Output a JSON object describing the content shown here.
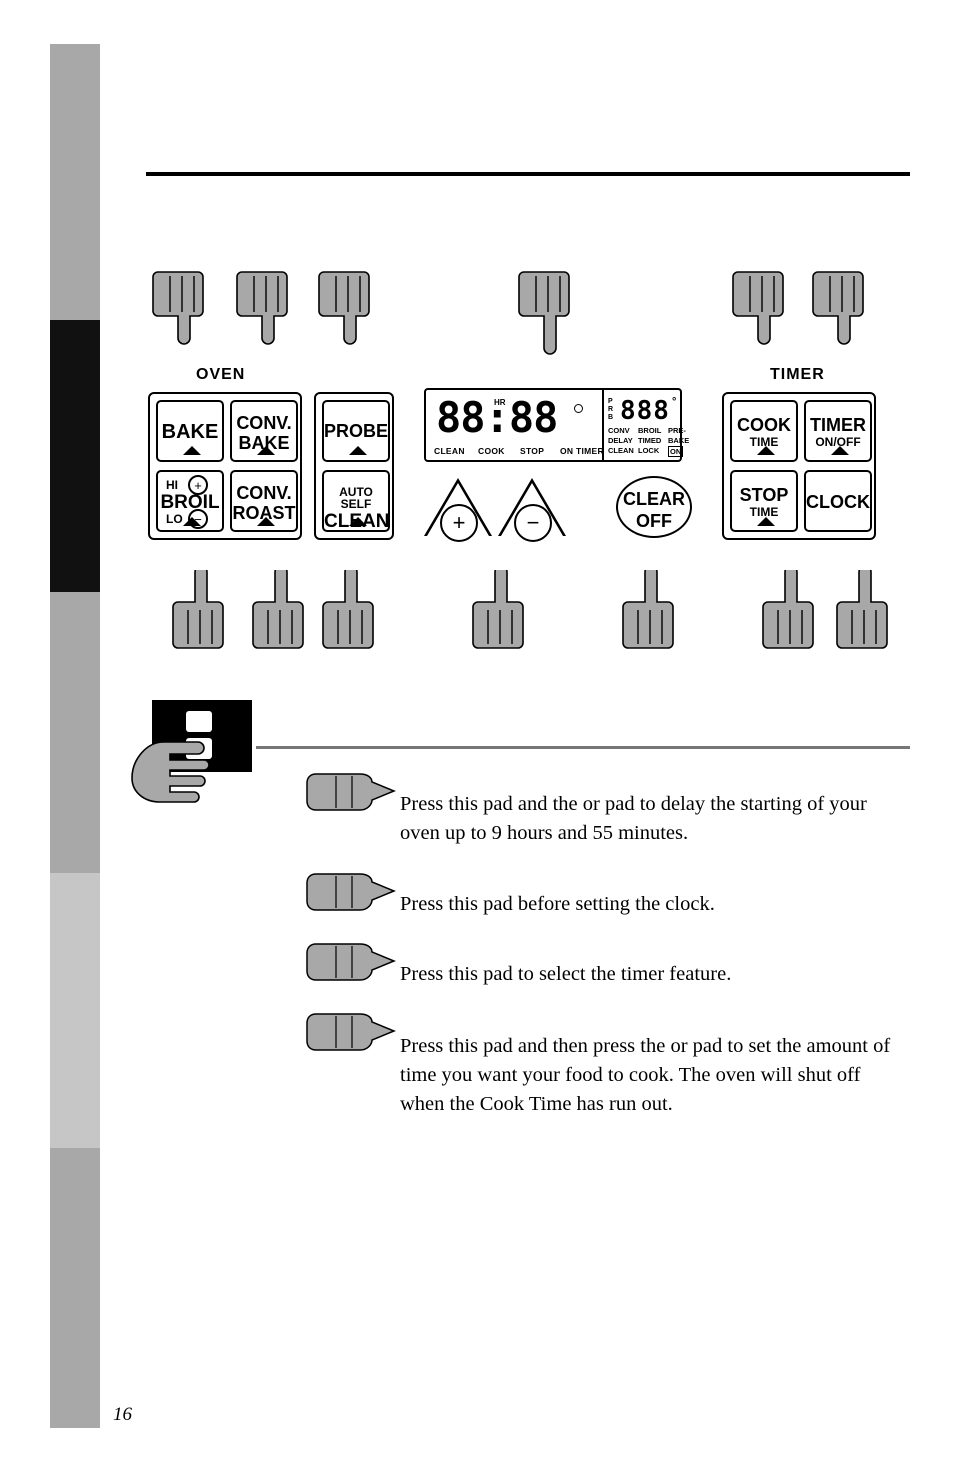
{
  "page": {
    "number": "16"
  },
  "panel": {
    "oven_label": "OVEN",
    "timer_label": "TIMER",
    "pads": {
      "bake": "BAKE",
      "conv_bake_l1": "CONV.",
      "conv_bake_l2": "BAKE",
      "probe": "PROBE",
      "broil_hi": "HI",
      "broil": "BROIL",
      "broil_lo": "LO",
      "conv_roast_l1": "CONV.",
      "conv_roast_l2": "ROAST",
      "auto_self": "AUTO SELF",
      "clean": "CLEAN",
      "cook_l1": "COOK",
      "cook_l2": "TIME",
      "timer_l1": "TIMER",
      "timer_l2": "ON/OFF",
      "stop_l1": "STOP",
      "stop_l2": "TIME",
      "clock": "CLOCK",
      "clear_l1": "CLEAR",
      "clear_l2": "OFF",
      "plus": "+",
      "minus": "−"
    },
    "display": {
      "main_digits": "88:88",
      "hr_label": "HR",
      "left_indicators": [
        "CLEAN",
        "COOK",
        "STOP",
        "ON TIMER"
      ],
      "right_digits": "888",
      "degree": "°",
      "prb_lines": [
        "P",
        "R",
        "B"
      ],
      "right_row1": [
        "CONV",
        "BROIL",
        "PRE-"
      ],
      "right_row2": [
        "DELAY",
        "TIMED",
        "BAKE"
      ],
      "right_row3": [
        "CLEAN",
        "LOCK",
        "ON"
      ]
    }
  },
  "instructions": [
    {
      "name": "delay-start",
      "text": "Press this pad and the     or     pad to delay the starting of your oven up to 9 hours and 55 minutes."
    },
    {
      "name": "before-clock",
      "text": "Press this pad before setting the clock."
    },
    {
      "name": "timer-feature",
      "text": "Press this pad to select the timer feature."
    },
    {
      "name": "cook-time",
      "text": "Press this pad and then press the     or     pad to set the amount of time you want your food to cook. The oven will shut off when the Cook Time has run out."
    }
  ]
}
